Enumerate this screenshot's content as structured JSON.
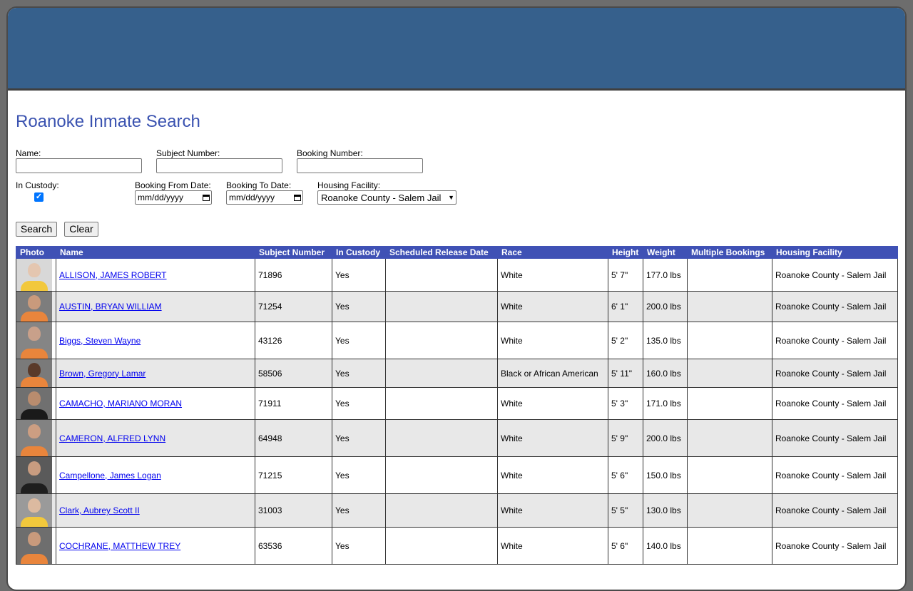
{
  "page": {
    "title": "Roanoke Inmate Search"
  },
  "form": {
    "name_label": "Name:",
    "subject_number_label": "Subject Number:",
    "booking_number_label": "Booking Number:",
    "in_custody_label": "In Custody:",
    "in_custody_checked": true,
    "booking_from_label": "Booking From Date:",
    "booking_to_label": "Booking To Date:",
    "date_placeholder": "mm/dd/yyyy",
    "housing_label": "Housing Facility:",
    "housing_selected": "Roanoke County - Salem Jail",
    "search_button": "Search",
    "clear_button": "Clear"
  },
  "table": {
    "headers": [
      "Photo",
      "Name",
      "Subject Number",
      "In Custody",
      "Scheduled Release Date",
      "Race",
      "Height",
      "Weight",
      "Multiple Bookings",
      "Housing Facility"
    ],
    "rows": [
      {
        "name": "ALLISON, JAMES ROBERT",
        "subject": "71896",
        "custody": "Yes",
        "release": "",
        "race": "White",
        "height": "5' 7\"",
        "weight": "177.0 lbs",
        "multiple": "",
        "facility": "Roanoke County - Salem Jail",
        "shirt": "#f2c83c",
        "skin": "#e4c6b0",
        "bg": "#d8d8d8"
      },
      {
        "name": "AUSTIN, BRYAN WILLIAM",
        "subject": "71254",
        "custody": "Yes",
        "release": "",
        "race": "White",
        "height": "6' 1\"",
        "weight": "200.0 lbs",
        "multiple": "",
        "facility": "Roanoke County - Salem Jail",
        "shirt": "#e9853c",
        "skin": "#c99a7c",
        "bg": "#7d7d7d"
      },
      {
        "name": "Biggs, Steven Wayne",
        "subject": "43126",
        "custody": "Yes",
        "release": "",
        "race": "White",
        "height": "5' 2\"",
        "weight": "135.0 lbs",
        "multiple": "",
        "facility": "Roanoke County - Salem Jail",
        "shirt": "#e9853c",
        "skin": "#c8a08a",
        "bg": "#858585"
      },
      {
        "name": "Brown, Gregory Lamar",
        "subject": "58506",
        "custody": "Yes",
        "release": "",
        "race": "Black or African American",
        "height": "5' 11\"",
        "weight": "160.0 lbs",
        "multiple": "",
        "facility": "Roanoke County - Salem Jail",
        "shirt": "#e9853c",
        "skin": "#5a3a2a",
        "bg": "#7a7a7a"
      },
      {
        "name": "CAMACHO, MARIANO MORAN",
        "subject": "71911",
        "custody": "Yes",
        "release": "",
        "race": "White",
        "height": "5' 3\"",
        "weight": "171.0 lbs",
        "multiple": "",
        "facility": "Roanoke County - Salem Jail",
        "shirt": "#1a1a1a",
        "skin": "#b98c6e",
        "bg": "#707070"
      },
      {
        "name": "CAMERON, ALFRED LYNN",
        "subject": "64948",
        "custody": "Yes",
        "release": "",
        "race": "White",
        "height": "5' 9\"",
        "weight": "200.0 lbs",
        "multiple": "",
        "facility": "Roanoke County - Salem Jail",
        "shirt": "#e9853c",
        "skin": "#cc9e82",
        "bg": "#828282"
      },
      {
        "name": "Campellone, James Logan",
        "subject": "71215",
        "custody": "Yes",
        "release": "",
        "race": "White",
        "height": "5' 6\"",
        "weight": "150.0 lbs",
        "multiple": "",
        "facility": "Roanoke County - Salem Jail",
        "shirt": "#1e1e1e",
        "skin": "#c89c80",
        "bg": "#5a5a5a"
      },
      {
        "name": "Clark, Aubrey Scott II",
        "subject": "31003",
        "custody": "Yes",
        "release": "",
        "race": "White",
        "height": "5' 5\"",
        "weight": "130.0 lbs",
        "multiple": "",
        "facility": "Roanoke County - Salem Jail",
        "shirt": "#f2c83c",
        "skin": "#dcbaa0",
        "bg": "#9a9a9a"
      },
      {
        "name": "COCHRANE, MATTHEW TREY",
        "subject": "63536",
        "custody": "Yes",
        "release": "",
        "race": "White",
        "height": "5' 6\"",
        "weight": "140.0 lbs",
        "multiple": "",
        "facility": "Roanoke County - Salem Jail",
        "shirt": "#e9853c",
        "skin": "#c99a7c",
        "bg": "#6e6e6e"
      }
    ]
  }
}
